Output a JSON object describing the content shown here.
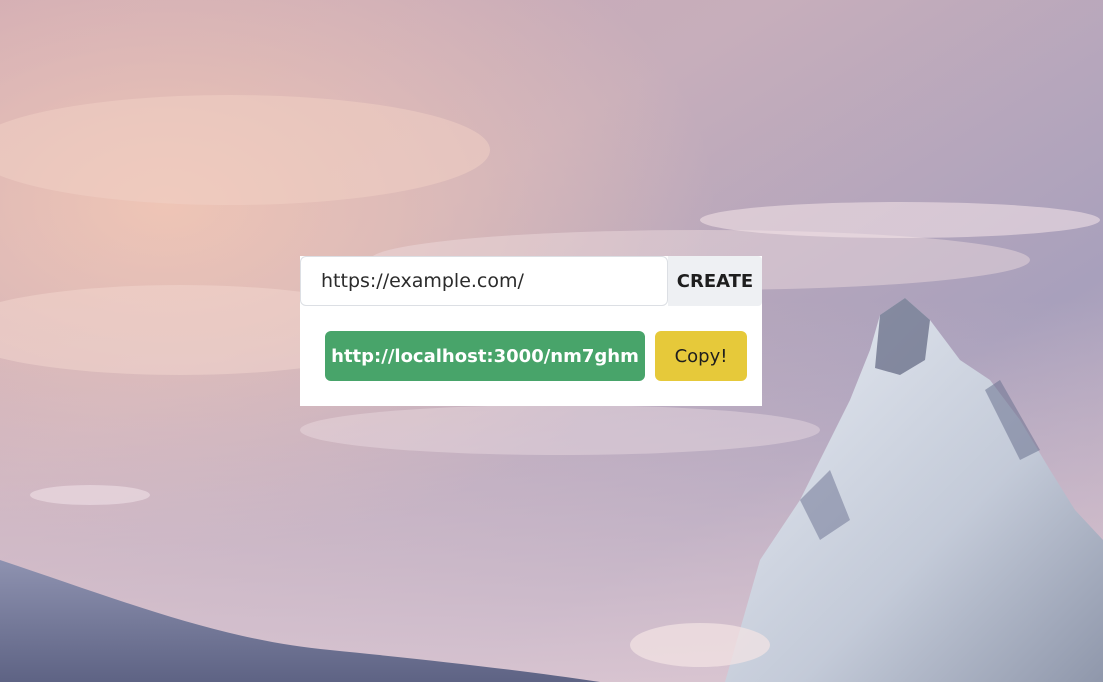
{
  "form": {
    "url_input_value": "https://example.com/",
    "create_label": "CREATE"
  },
  "result": {
    "short_url": "http://localhost:3000/nm7ghm",
    "copy_label": "Copy!"
  },
  "colors": {
    "short_url_bg": "#48a46a",
    "copy_bg": "#e6c93a",
    "create_bg": "#eef0f3"
  }
}
